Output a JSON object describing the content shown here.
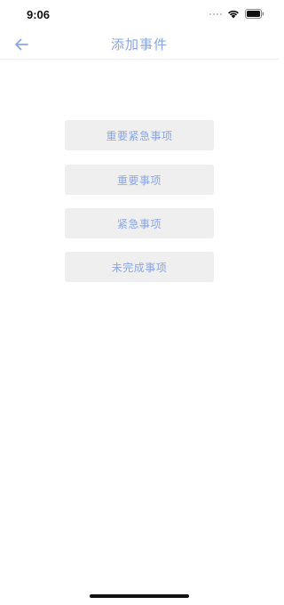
{
  "status_bar": {
    "time": "9:06"
  },
  "nav": {
    "title": "添加事件"
  },
  "options": [
    {
      "label": "重要紧急事项"
    },
    {
      "label": "重要事项"
    },
    {
      "label": "紧急事项"
    },
    {
      "label": "未完成事项"
    }
  ],
  "colors": {
    "accent": "#8aa5ea",
    "button_bg": "#efefef",
    "background": "#ffffff"
  }
}
